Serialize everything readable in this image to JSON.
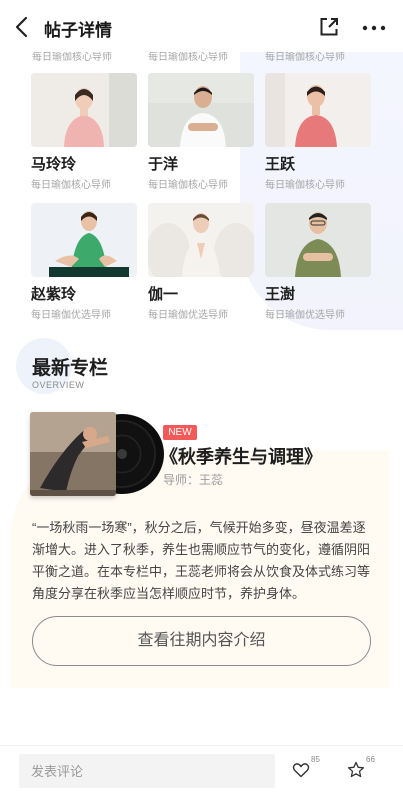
{
  "header": {
    "title": "帖子详情"
  },
  "top_subtitles": [
    "每日瑜伽核心导师",
    "每日瑜伽核心导师",
    "每日瑜伽核心导师"
  ],
  "teachers": [
    {
      "name": "马玲玲",
      "role": "每日瑜伽核心导师"
    },
    {
      "name": "于洋",
      "role": "每日瑜伽核心导师"
    },
    {
      "name": "王跃",
      "role": "每日瑜伽核心导师"
    },
    {
      "name": "赵紫玲",
      "role": "每日瑜伽优选导师"
    },
    {
      "name": "伽一",
      "role": "每日瑜伽优选导师"
    },
    {
      "name": "王澍",
      "role": "每日瑜伽优选导师"
    }
  ],
  "section": {
    "title": "最新专栏",
    "subtitle": "OVERVIEW"
  },
  "column": {
    "badge": "NEW",
    "title": "《秋季养生与调理》",
    "teacher": "导师：王蕊",
    "description": "“一场秋雨一场寒”，秋分之后，气候开始多变，昼夜温差逐渐增大。进入了秋季，养生也需顺应节气的变化，遵循阴阳平衡之道。在本专栏中，王蕊老师将会从饮食及体式练习等角度分享在秋季应当怎样顺应时节，养护身体。",
    "history_button": "查看往期内容介绍"
  },
  "bottom_bar": {
    "comment_placeholder": "发表评论",
    "like_count": "85",
    "star_count": "66"
  },
  "colors": {
    "badge": "#f15a58",
    "text_primary": "#1e1e1e",
    "text_secondary": "#a5a5a5"
  }
}
